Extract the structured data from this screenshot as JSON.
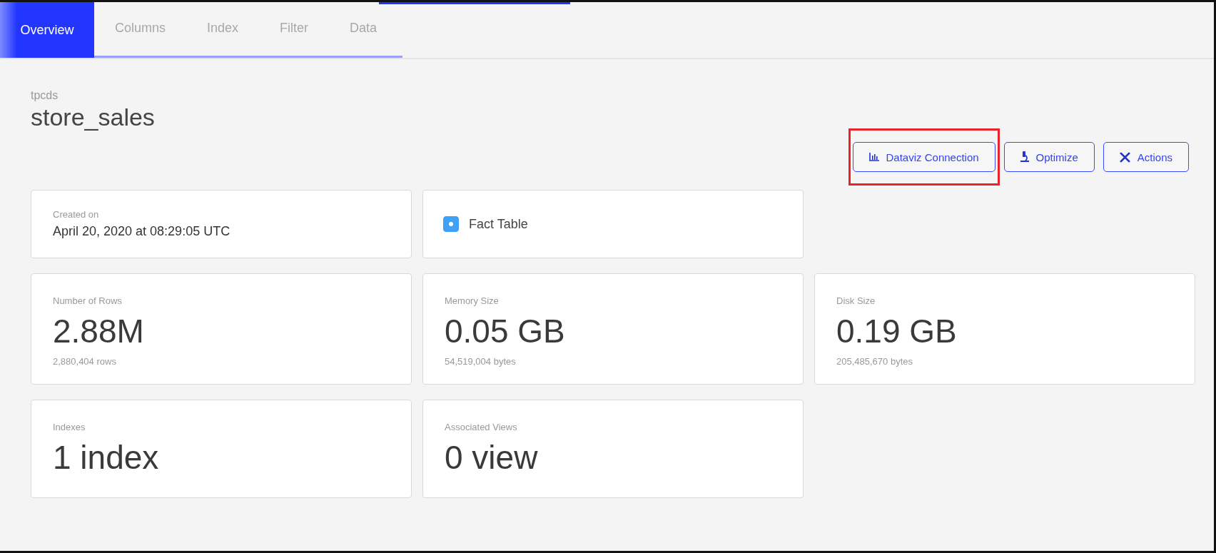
{
  "tabs": [
    {
      "label": "Overview",
      "selected": true
    },
    {
      "label": "Columns",
      "selected": false
    },
    {
      "label": "Index",
      "selected": false
    },
    {
      "label": "Filter",
      "selected": false
    },
    {
      "label": "Data",
      "selected": false
    }
  ],
  "header": {
    "schema": "tpcds",
    "table": "store_sales"
  },
  "buttons": [
    {
      "label": "Dataviz Connection",
      "kind": "chart",
      "highlighted": true
    },
    {
      "label": "Optimize",
      "kind": "microscope",
      "highlighted": false
    },
    {
      "label": "Actions",
      "kind": "tools",
      "highlighted": false
    }
  ],
  "cards": [
    {
      "kind": "info",
      "label": "Created on",
      "value": "April 20, 2020 at 08:29:05 UTC"
    },
    {
      "kind": "check",
      "label": "Fact Table",
      "checked": true
    },
    {
      "kind": "blank"
    },
    {
      "kind": "metric",
      "label": "Number of Rows",
      "value": "2.88M",
      "detail": "2,880,404 rows"
    },
    {
      "kind": "metric",
      "label": "Memory Size",
      "value": "0.05 GB",
      "detail": "54,519,004 bytes"
    },
    {
      "kind": "metric",
      "label": "Disk Size",
      "value": "0.19 GB",
      "detail": "205,485,670 bytes"
    },
    {
      "kind": "metric",
      "label": "Indexes",
      "value": "1 index"
    },
    {
      "kind": "metric",
      "label": "Associated Views",
      "value": "0 view"
    }
  ]
}
